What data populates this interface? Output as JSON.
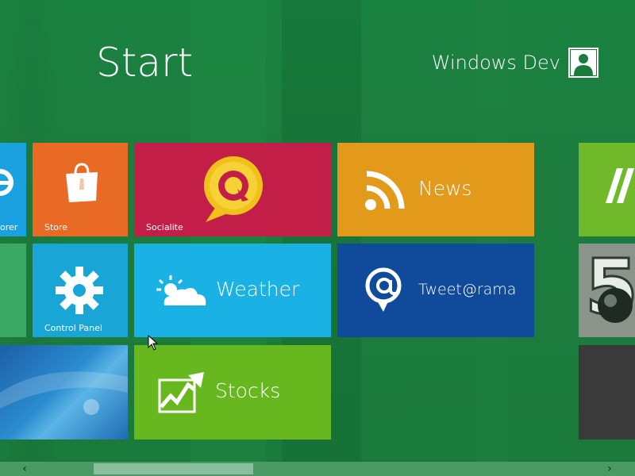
{
  "header": {
    "title": "Start",
    "user_name": "Windows Dev"
  },
  "tiles": {
    "explorer": {
      "label": "orer",
      "color": "#1aa1e0"
    },
    "store": {
      "label": "Store",
      "color": "#e86a25"
    },
    "socialite": {
      "label": "Socialite",
      "color": "#c21e47"
    },
    "news": {
      "label": "News",
      "color": "#e39a1a"
    },
    "right_top": {
      "label": "",
      "color": "#6fb92a"
    },
    "green_left": {
      "label": "",
      "color": "#3aa964"
    },
    "control_panel": {
      "label": "Control Panel",
      "color": "#19a6d6"
    },
    "weather": {
      "label": "Weather",
      "color": "#1ab2e4"
    },
    "tweetarama": {
      "label": "Tweet@rama",
      "color": "#0f4b9a"
    },
    "right_mid": {
      "label": "",
      "color": "#7f8a82"
    },
    "desktop": {
      "label": "",
      "color": "#1e6db4"
    },
    "stocks": {
      "label": "Stocks",
      "color": "#67b81f"
    },
    "right_bottom": {
      "label": "",
      "color": "#3a3a3a"
    }
  },
  "scrollbar": {
    "left_arrow": "‹",
    "right_arrow": "›"
  },
  "icons": [
    "ie-icon",
    "store-bag-icon",
    "socialite-icon",
    "rss-icon",
    "gear-icon",
    "weather-icon",
    "at-sign-icon",
    "stocks-chart-icon",
    "user-avatar-icon",
    "cursor-icon"
  ]
}
